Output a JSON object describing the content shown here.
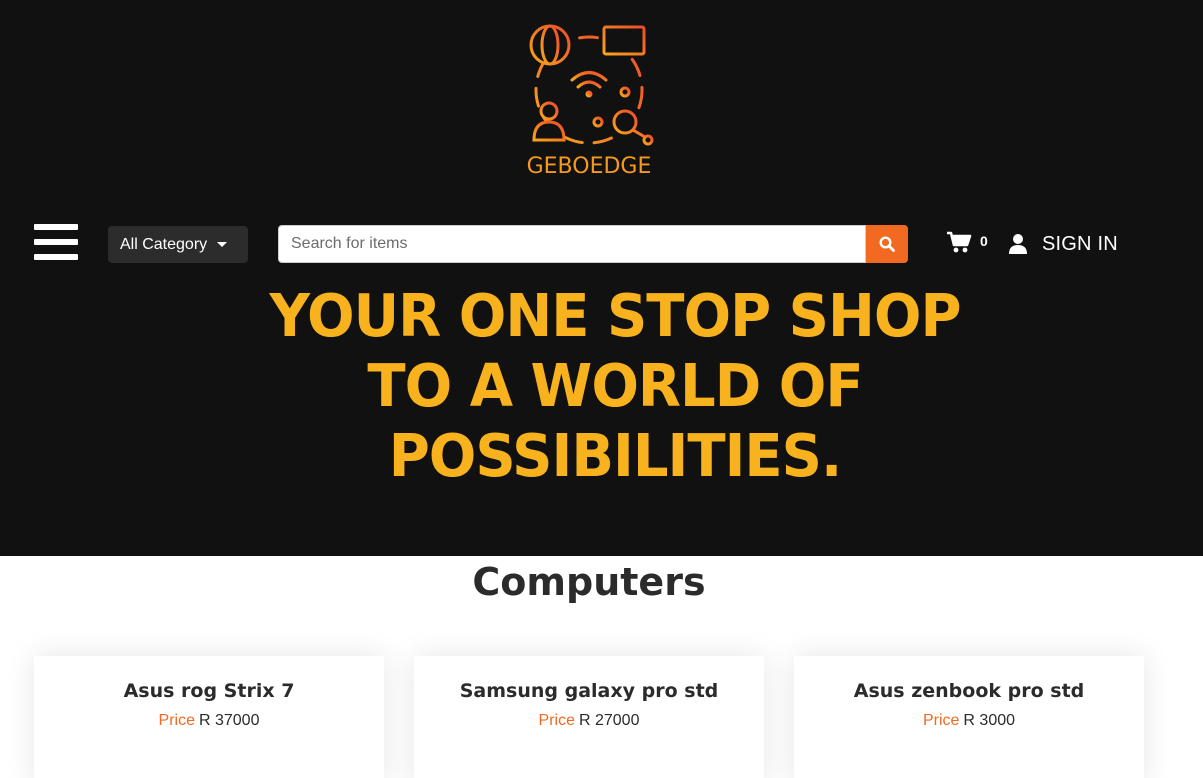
{
  "brand": {
    "name": "GEBOEDGE",
    "logo_icon": "network-devices-logo"
  },
  "nav": {
    "menu_icon": "hamburger-icon",
    "category_label": "All Category",
    "search_placeholder": "Search for items",
    "search_value": "",
    "cart_count": "0",
    "signin_label": "SIGN IN"
  },
  "hero": {
    "tagline": [
      "YOUR ONE STOP SHOP",
      "TO A WORLD OF",
      "POSSIBILITIES."
    ]
  },
  "section": {
    "title": "Computers",
    "products": [
      {
        "name": "Asus rog Strix 7",
        "price_label": "Price",
        "price_value": "R 37000"
      },
      {
        "name": "Samsung galaxy pro std",
        "price_label": "Price",
        "price_value": "R 27000"
      },
      {
        "name": "Asus zenbook pro std",
        "price_label": "Price",
        "price_value": "R 3000"
      }
    ]
  },
  "colors": {
    "accent": "#f26a21",
    "tagline": "#f7b21d",
    "hero_bg": "#121111"
  }
}
